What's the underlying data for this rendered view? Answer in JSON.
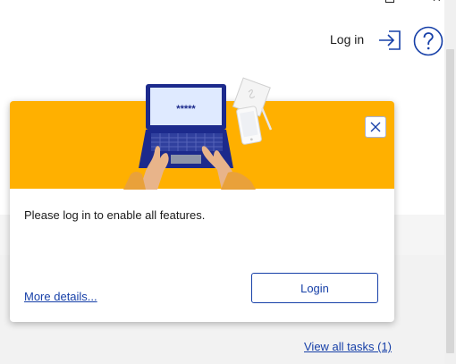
{
  "header": {
    "login_label": "Log in"
  },
  "popup": {
    "laptop_screen_text": "*****",
    "message": "Please log in to enable all features.",
    "more_details_label": "More details...",
    "login_button_label": "Login"
  },
  "footer": {
    "view_all_tasks_label": "View all tasks (1)"
  },
  "colors": {
    "banner": "#ffb000",
    "accent_blue": "#1740a8",
    "laptop_body": "#1c2a8c"
  }
}
